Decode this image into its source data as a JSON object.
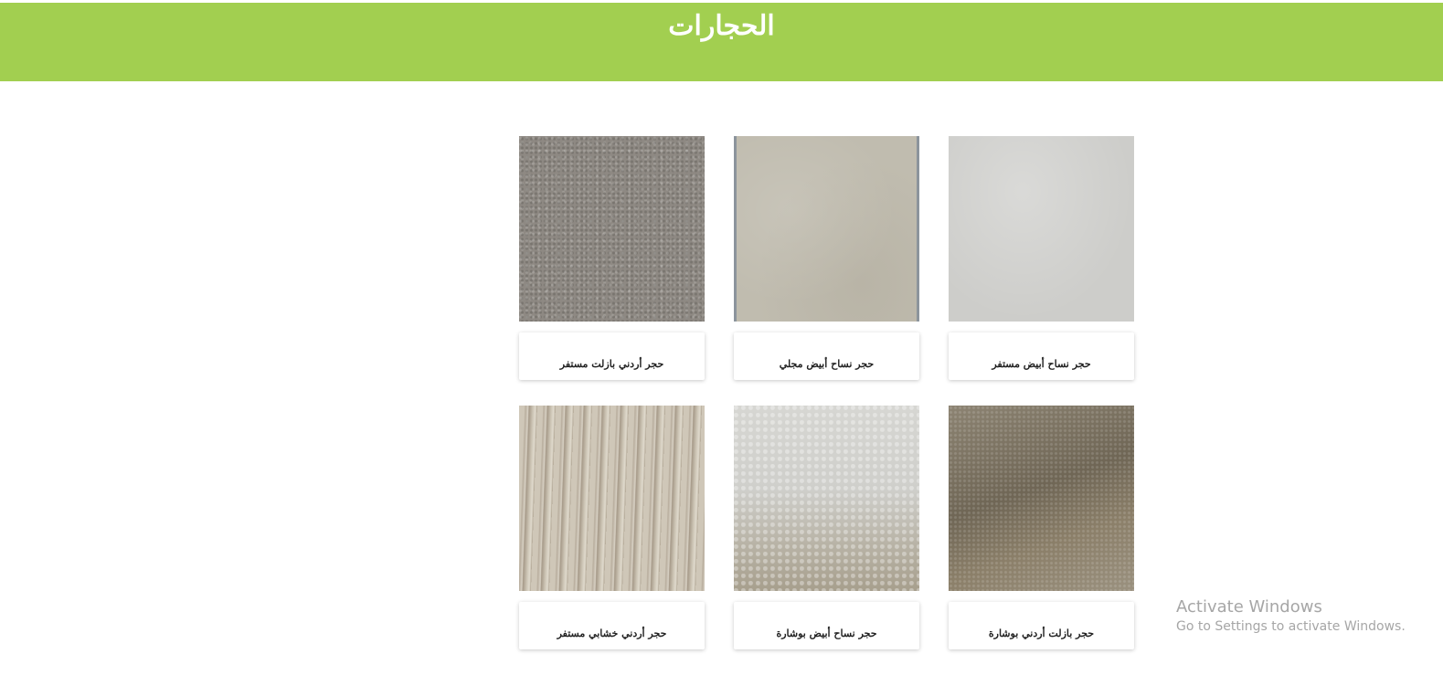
{
  "header": {
    "title": "الحجارات",
    "color": "#a2cf50"
  },
  "stones": [
    {
      "label": "حجر أردني بازلت مستفر",
      "texture": "gray-granite"
    },
    {
      "label": "حجر نساح أبيض مجلي",
      "texture": "beige"
    },
    {
      "label": "حجر نساح أبيض مستفر",
      "texture": "light-gray"
    },
    {
      "label": "حجر أردني خشابي مستفر",
      "texture": "travertine"
    },
    {
      "label": "حجر نساح أبيض بوشارة",
      "texture": "white-leather"
    },
    {
      "label": "حجر بازلت أردني بوشارة",
      "texture": "dark-sand"
    }
  ],
  "watermark": {
    "title": "Activate Windows",
    "subtitle": "Go to Settings to activate Windows."
  }
}
